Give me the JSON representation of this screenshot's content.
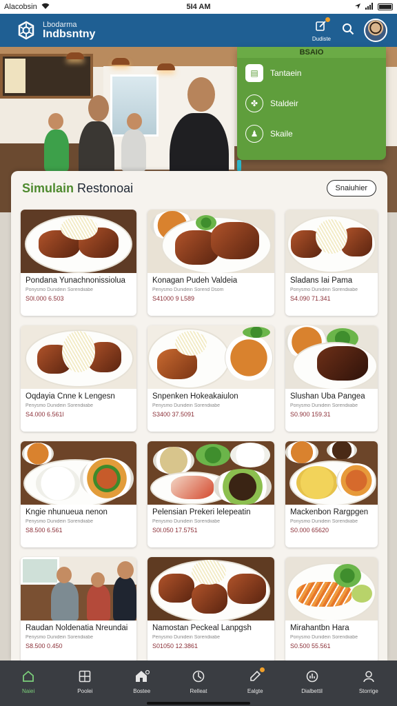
{
  "status_bar": {
    "carrier": "Alacobsin",
    "time": "5I4 AM"
  },
  "header": {
    "brand_top": "Lbodarma",
    "brand_bottom": "Indbsntny",
    "notify_label": "Dudiste",
    "accent_color": "#1f5f93"
  },
  "dropdown": {
    "title": "BSAIO",
    "items": [
      {
        "label": "Tantaein",
        "icon": "calendar-icon"
      },
      {
        "label": "Staldeir",
        "icon": "plant-icon"
      },
      {
        "label": "Skaile",
        "icon": "person-icon"
      }
    ],
    "color": "#5f9e3c"
  },
  "main": {
    "title_green": "Simulain",
    "title_rest": "Restonoai",
    "action_button": "Snaiuhier"
  },
  "dishes": [
    {
      "name": "Pondana Yunachnonissiolua",
      "desc": "Ponysmo Dunidein Sorendiiabe",
      "price": "S0l.000 6.503"
    },
    {
      "name": "Konagan Pudeh Valdeia",
      "desc": "Penysmo Dunidein Sorend Dsom",
      "price": "S41000 9 L589"
    },
    {
      "name": "Sladans Iai Pama",
      "desc": "Ponysmo Dunidein Sorendiiabe",
      "price": "S4.090 71.341"
    },
    {
      "name": "Oqdayia Cnne k Lengesn",
      "desc": "Penysmo Dunidein Sorendiiabe",
      "price": "S4.000 6.561l"
    },
    {
      "name": "Snpenken Hokeakaiulon",
      "desc": "Penysmo Dunidein Sorendiiabe",
      "price": "S3400 37.5091"
    },
    {
      "name": "Slushan Uba Pangea",
      "desc": "Ponysmo Dunidein Sorendiiabe",
      "price": "S0.900 159.31"
    },
    {
      "name": "Kngie nhunueua nenon",
      "desc": "Penysmo Dunidein Sorendiiabe",
      "price": "S8.500 6.561"
    },
    {
      "name": "Pelensian Prekeri lelepeatin",
      "desc": "Penysmo Dunidein Sorendiiabe",
      "price": "S0l.050 17.5751"
    },
    {
      "name": "Mackenbon Rargpgen",
      "desc": "Ponysmo Dunidein Sorendiiabe",
      "price": "S0.000 65620"
    },
    {
      "name": "Raudan Noldenatia Nreundai",
      "desc": "Penysmo Dunidein Sorendiiabe",
      "price": "S8.500 0.450"
    },
    {
      "name": "Namostan Peckeal Lanpgsh",
      "desc": "Penysmo Dunidein Sorendiiabe",
      "price": "S01050 12.3861"
    },
    {
      "name": "Mirahantbn Hara",
      "desc": "Ponysmo Dunidein Sorendiiabe",
      "price": "S0.500 55.561"
    }
  ],
  "bottom_nav": [
    {
      "label": "Naiei",
      "icon": "home-icon",
      "active": true
    },
    {
      "label": "Poolei",
      "icon": "grid-icon",
      "active": false
    },
    {
      "label": "Bostee",
      "icon": "store-icon",
      "active": false
    },
    {
      "label": "Relleat",
      "icon": "target-icon",
      "active": false
    },
    {
      "label": "Ealgte",
      "icon": "edit-icon",
      "active": false
    },
    {
      "label": "Dialbettil",
      "icon": "chart-icon",
      "active": false
    },
    {
      "label": "Storrige",
      "icon": "user-icon",
      "active": false
    }
  ]
}
